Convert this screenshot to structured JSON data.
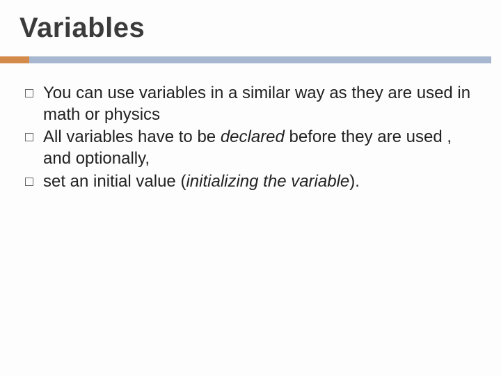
{
  "title": "Variables",
  "bullets": [
    {
      "pre": "You can use variables in a similar way as they are used in math or physics",
      "em": "",
      "post": ""
    },
    {
      "pre": "All variables have to be ",
      "em": "declared",
      "post": " before they are used , and optionally,"
    },
    {
      "pre": "set an initial value (",
      "em": "initializing the variable",
      "post": ")."
    }
  ]
}
